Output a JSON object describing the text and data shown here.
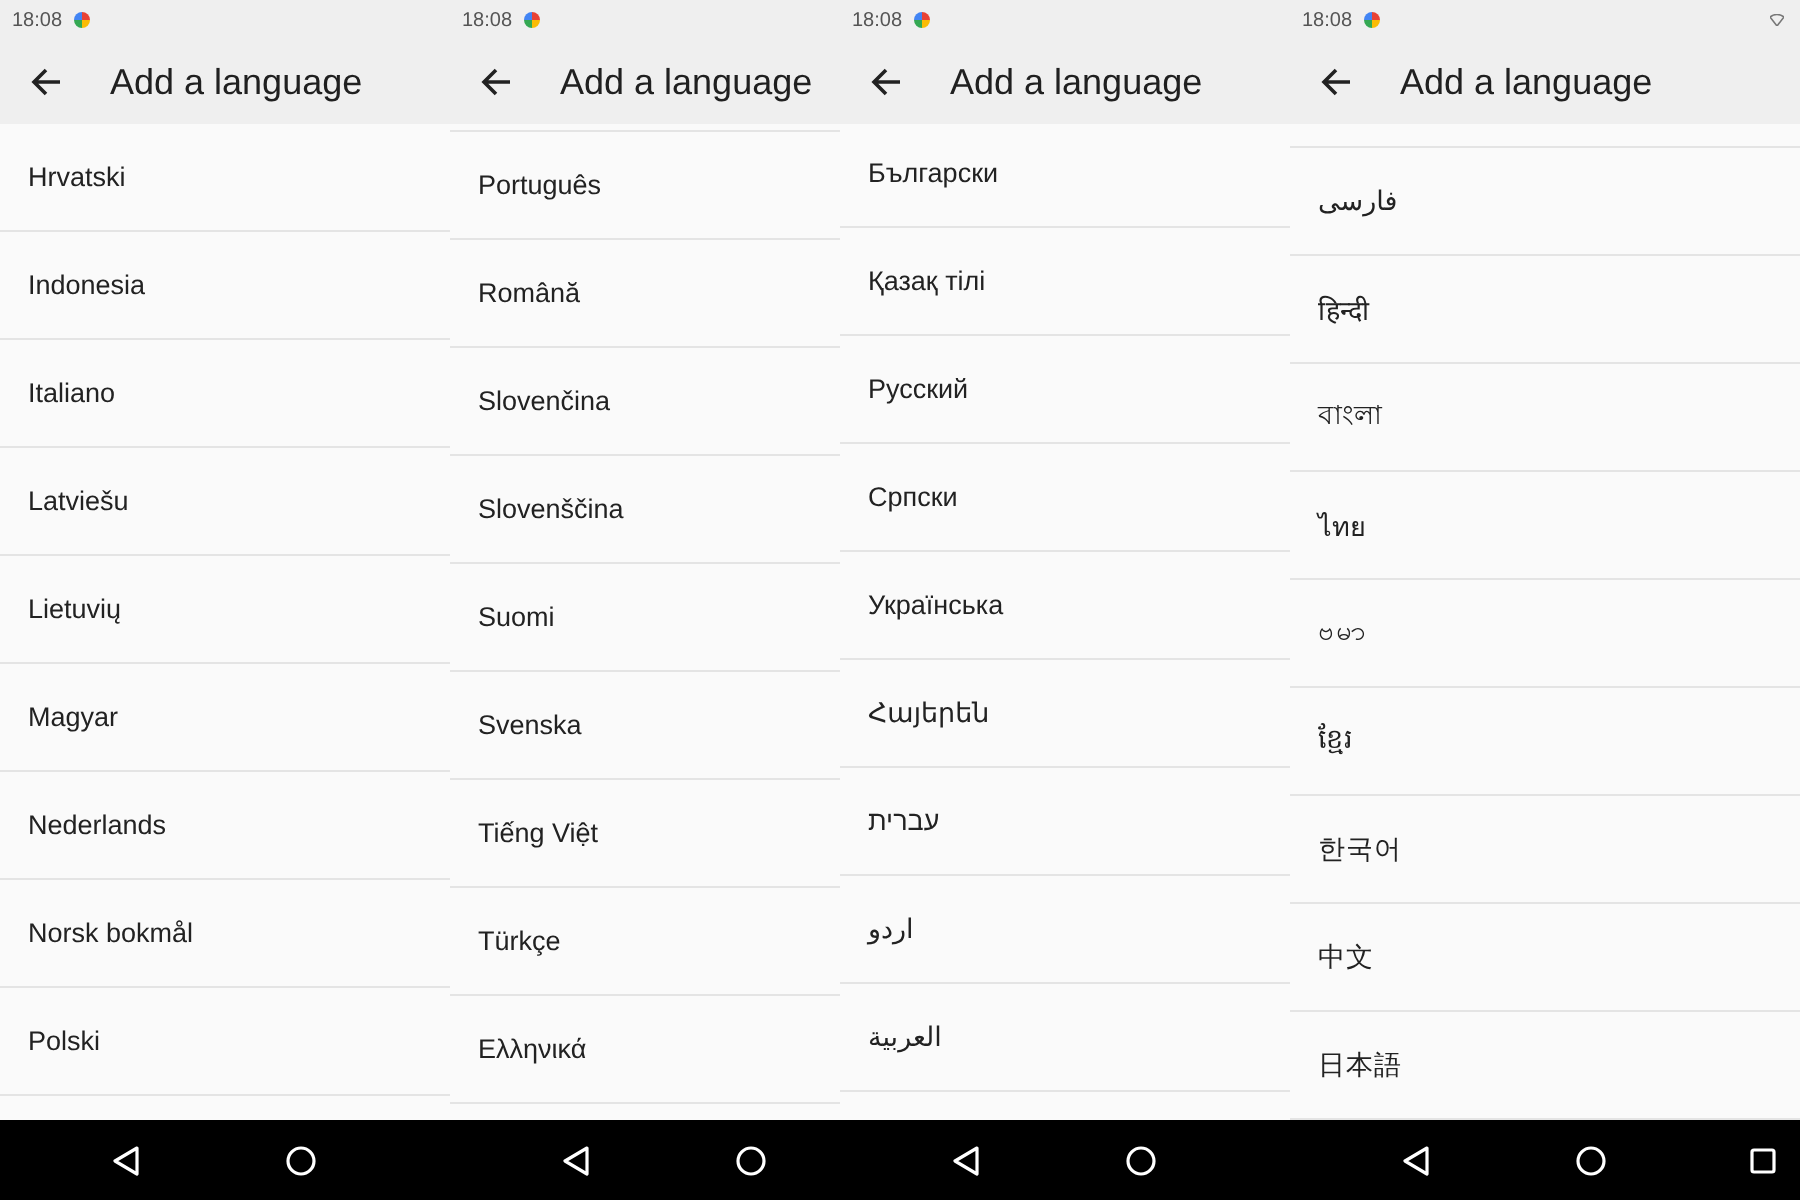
{
  "panels": [
    {
      "status_bar": {
        "time": "18:08",
        "icons": [
          {
            "kind": "app"
          }
        ]
      },
      "header": {
        "title": "Add a language"
      },
      "languages": [
        "Hrvatski",
        "Indonesia",
        "Italiano",
        "Latviešu",
        "Lietuvių",
        "Magyar",
        "Nederlands",
        "Norsk bokmål",
        "Polski"
      ],
      "nav_bar": [
        {
          "kind": "back"
        },
        {
          "kind": "home"
        }
      ]
    },
    {
      "status_bar": {
        "time": "18:08",
        "icons": [
          {
            "kind": "app"
          }
        ]
      },
      "header": {
        "title": "Add a language"
      },
      "languages": [
        "Português",
        "Română",
        "Slovenčina",
        "Slovenščina",
        "Suomi",
        "Svenska",
        "Tiếng Việt",
        "Türkçe",
        "Ελληνικά"
      ],
      "nav_bar": [
        {
          "kind": "back"
        },
        {
          "kind": "home"
        }
      ]
    },
    {
      "status_bar": {
        "time": "18:08",
        "icons": [
          {
            "kind": "app"
          }
        ]
      },
      "header": {
        "title": "Add a language"
      },
      "languages": [
        "Български",
        "Қазақ тілі",
        "Русский",
        "Српски",
        "Українська",
        "Հայերեն",
        "עברית",
        "اردو",
        "العربية"
      ],
      "nav_bar": [
        {
          "kind": "back"
        },
        {
          "kind": "home"
        }
      ]
    },
    {
      "status_bar": {
        "time": "18:08",
        "icons": [
          {
            "kind": "app"
          },
          {
            "kind": "wifi"
          }
        ]
      },
      "header": {
        "title": "Add a language"
      },
      "languages": [
        "فارسی",
        "हिन्दी",
        "বাংলা",
        "ไทย",
        "ဗမာ",
        "ខ្មែរ",
        "한국어",
        "中文",
        "日本語"
      ],
      "nav_bar": [
        {
          "kind": "back"
        },
        {
          "kind": "home"
        },
        {
          "kind": "recents"
        }
      ]
    }
  ]
}
